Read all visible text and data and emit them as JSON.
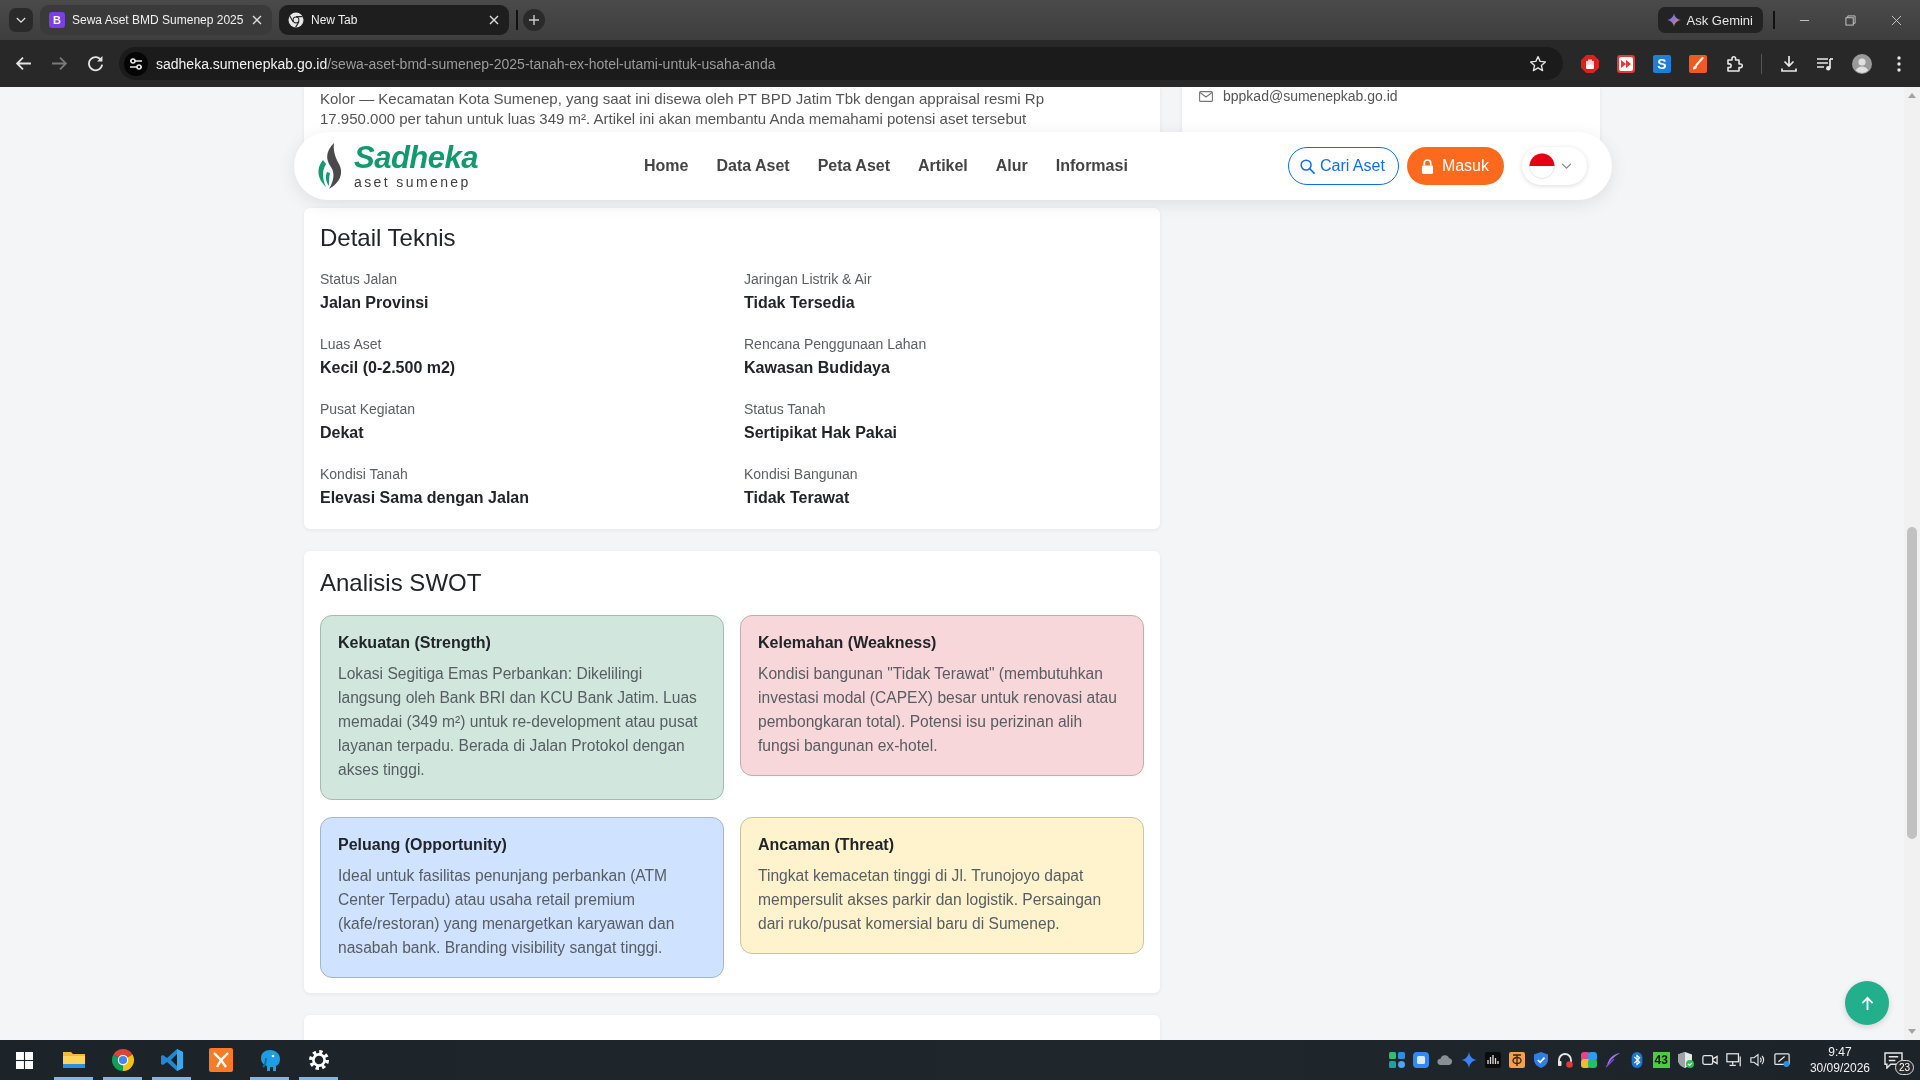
{
  "browser": {
    "tabs": [
      {
        "title": "Sewa Aset BMD Sumenep 2025",
        "favicon_letter": "B",
        "selected": true
      },
      {
        "title": "New Tab",
        "selected": false
      }
    ],
    "ask_button": "Ask Gemini",
    "forward_disabled": true,
    "url_host": "sadheka.sumenepkab.go.id",
    "url_path": "/sewa-aset-bmd-sumenep-2025-tanah-ex-hotel-utami-untuk-usaha-anda",
    "extension_letter": "S"
  },
  "article": {
    "intro_lines": [
      "Kolor — Kecamatan Kota Sumenep, yang saat ini disewa oleh PT BPD Jatim Tbk dengan appraisal resmi Rp",
      "17.950.000 per tahun untuk luas 349 m². Artikel ini akan membantu Anda memahami potensi aset tersebut"
    ]
  },
  "sidebar": {
    "email": "bppkad@sumenepkab.go.id"
  },
  "navbar": {
    "logo_name": "Sadheka",
    "logo_tagline": "aset sumenep",
    "links": [
      "Home",
      "Data Aset",
      "Peta Aset",
      "Artikel",
      "Alur",
      "Informasi"
    ],
    "search_button": "Cari Aset",
    "login_button": "Masuk"
  },
  "detail": {
    "title": "Detail Teknis",
    "fields": [
      {
        "label": "Status Jalan",
        "value": "Jalan Provinsi"
      },
      {
        "label": "Jaringan Listrik & Air",
        "value": "Tidak Tersedia"
      },
      {
        "label": "Luas Aset",
        "value": "Kecil (0-2.500 m2)"
      },
      {
        "label": "Rencana Penggunaan Lahan",
        "value": "Kawasan Budidaya"
      },
      {
        "label": "Pusat Kegiatan",
        "value": "Dekat"
      },
      {
        "label": "Status Tanah",
        "value": "Sertipikat Hak Pakai"
      },
      {
        "label": "Kondisi Tanah",
        "value": "Elevasi Sama dengan Jalan"
      },
      {
        "label": "Kondisi Bangunan",
        "value": "Tidak Terawat"
      }
    ]
  },
  "swot": {
    "title": "Analisis SWOT",
    "items": [
      {
        "title": "Kekuatan (Strength)",
        "text": "Lokasi Segitiga Emas Perbankan: Dikelilingi langsung oleh Bank BRI dan KCU Bank Jatim. Luas memadai (349 m²) untuk re-development atau pusat layanan terpadu. Berada di Jalan Protokol dengan akses tinggi.",
        "color": "#d1e7dd"
      },
      {
        "title": "Kelemahan (Weakness)",
        "text": "Kondisi bangunan \"Tidak Terawat\" (membutuhkan investasi modal (CAPEX) besar untuk renovasi atau pembongkaran total). Potensi isu perizinan alih fungsi bangunan ex-hotel.",
        "color": "#f8d7da"
      },
      {
        "title": "Peluang (Opportunity)",
        "text": "Ideal untuk fasilitas penunjang perbankan (ATM Center Terpadu) atau usaha retail premium (kafe/restoran) yang menargetkan karyawan dan nasabah bank. Branding visibility sangat tinggi.",
        "color": "#cfe2ff"
      },
      {
        "title": "Ancaman (Threat)",
        "text": "Tingkat kemacetan tinggi di Jl. Trunojoyo dapat mempersulit akses parkir dan logistik. Persaingan dari ruko/pusat komersial baru di Sumenep.",
        "color": "#fff3cd"
      }
    ]
  },
  "taskbar": {
    "apps": [
      {
        "kind": "folder",
        "running": true
      },
      {
        "kind": "browser",
        "running": true
      },
      {
        "kind": "code",
        "running": true
      },
      {
        "kind": "tile",
        "running": false
      },
      {
        "kind": "elephant",
        "running": true
      },
      {
        "kind": "gear",
        "running": true
      }
    ],
    "tray_counter": "43",
    "time": "9:47",
    "date": "30/09/2026",
    "notification_count": "23"
  }
}
